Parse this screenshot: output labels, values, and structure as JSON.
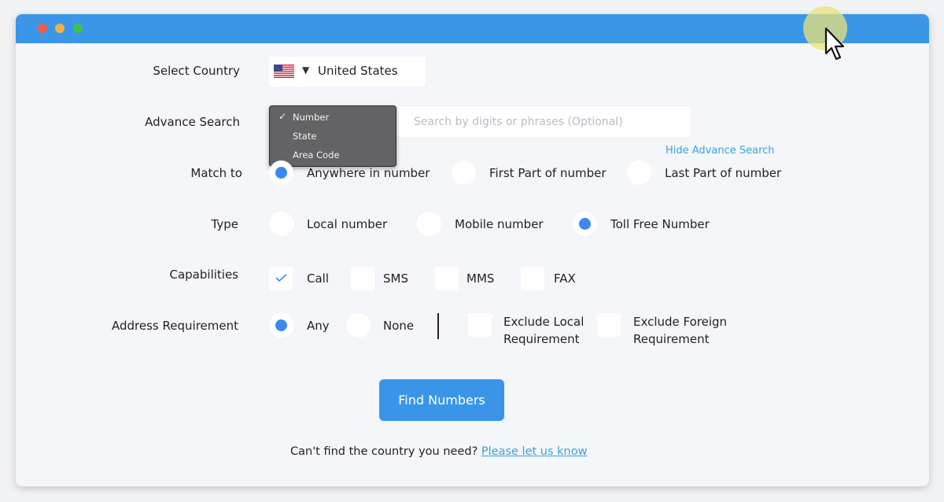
{
  "window": {
    "controls": [
      "close",
      "minimize",
      "maximize"
    ],
    "colors": {
      "titlebar": "#3b96e8",
      "close": "#ef5c50",
      "minimize": "#f3b23e",
      "maximize": "#3ec34a"
    }
  },
  "form": {
    "select_country": {
      "label": "Select Country",
      "flag_icon": "us-flag-icon",
      "value": "United States"
    },
    "advance_search": {
      "label": "Advance Search",
      "dropdown_options": [
        "Number",
        "State",
        "Area Code"
      ],
      "selected_option": "Number",
      "search_placeholder": "Search by digits or phrases (Optional)",
      "search_value": "",
      "hide_link": "Hide Advance Search"
    },
    "match_to": {
      "label": "Match to",
      "options": [
        "Anywhere in number",
        "First Part of number",
        "Last Part of number"
      ],
      "selected": "Anywhere in number"
    },
    "type": {
      "label": "Type",
      "options": [
        "Local number",
        "Mobile number",
        "Toll Free Number"
      ],
      "selected": "Toll Free Number"
    },
    "capabilities": {
      "label": "Capabilities",
      "options": [
        "Call",
        "SMS",
        "MMS",
        "FAX"
      ],
      "checked": [
        "Call"
      ]
    },
    "address_requirement": {
      "label": "Address Requirement",
      "options": [
        "Any",
        "None"
      ],
      "selected": "Any",
      "exclude_options": [
        {
          "line1": "Exclude Local",
          "line2": "Requirement"
        },
        {
          "line1": "Exclude Foreign",
          "line2": "Requirement"
        }
      ]
    },
    "submit_label": "Find Numbers"
  },
  "footer": {
    "text": "Can't find the country you need?",
    "link": "Please let us know"
  },
  "colors": {
    "accent": "#3a95e9",
    "radio_on": "#3d88ee",
    "link": "#3aa3d8"
  }
}
